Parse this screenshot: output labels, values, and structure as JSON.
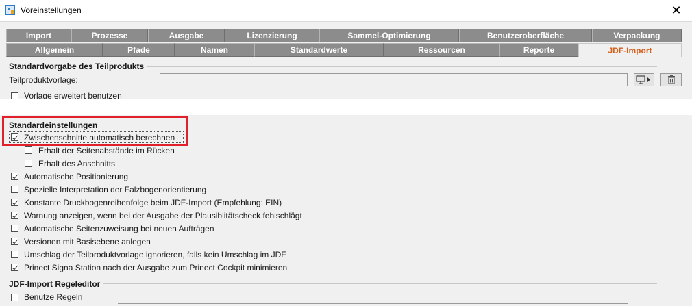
{
  "window": {
    "title": "Voreinstellungen",
    "close": "✕"
  },
  "tabs_row1": [
    "Import",
    "Prozesse",
    "Ausgabe",
    "Lizenzierung",
    "Sammel-Optimierung",
    "Benutzeroberfläche",
    "Verpackung"
  ],
  "tabs_row2": [
    "Allgemein",
    "Pfade",
    "Namen",
    "Standardwerte",
    "Ressourcen",
    "Reporte",
    "JDF-Import"
  ],
  "active_tab": "JDF-Import",
  "accent_color": "#d4601a",
  "highlight_color": "#e0202a",
  "teilprodukt": {
    "title": "Standardvorgabe des Teilprodukts",
    "field_label": "Teilproduktvorlage:",
    "field_value": "",
    "extended": {
      "label": "Vorlage erweitert benutzen",
      "checked": false
    }
  },
  "standard": {
    "title": "Standardeinstellungen",
    "items": [
      {
        "label": "Zwischenschnitte automatisch berechnen",
        "checked": true
      },
      {
        "label": "Erhalt der Seitenabstände im Rücken",
        "checked": false
      },
      {
        "label": "Erhalt des Anschnitts",
        "checked": false
      },
      {
        "label": "Automatische Positionierung",
        "checked": true
      },
      {
        "label": "Spezielle Interpretation der Falzbogenorientierung",
        "checked": false
      },
      {
        "label": "Konstante Druckbogenreihenfolge beim JDF-Import (Empfehlung: EIN)",
        "checked": true
      },
      {
        "label": "Warnung anzeigen, wenn bei der Ausgabe der Plausiblitätscheck fehlschlägt",
        "checked": true
      },
      {
        "label": "Automatische Seitenzuweisung bei neuen Aufträgen",
        "checked": false
      },
      {
        "label": "Versionen mit Basisebene anlegen",
        "checked": true
      },
      {
        "label": "Umschlag der Teilproduktvorlage ignorieren, falls kein Umschlag im JDF",
        "checked": false
      },
      {
        "label": "Prinect Signa Station nach der Ausgabe zum Prinect Cockpit minimieren",
        "checked": true
      }
    ]
  },
  "regeleditor": {
    "title": "JDF-Import Regeleditor",
    "use_rules": {
      "label": "Benutze Regeln",
      "checked": false
    }
  }
}
